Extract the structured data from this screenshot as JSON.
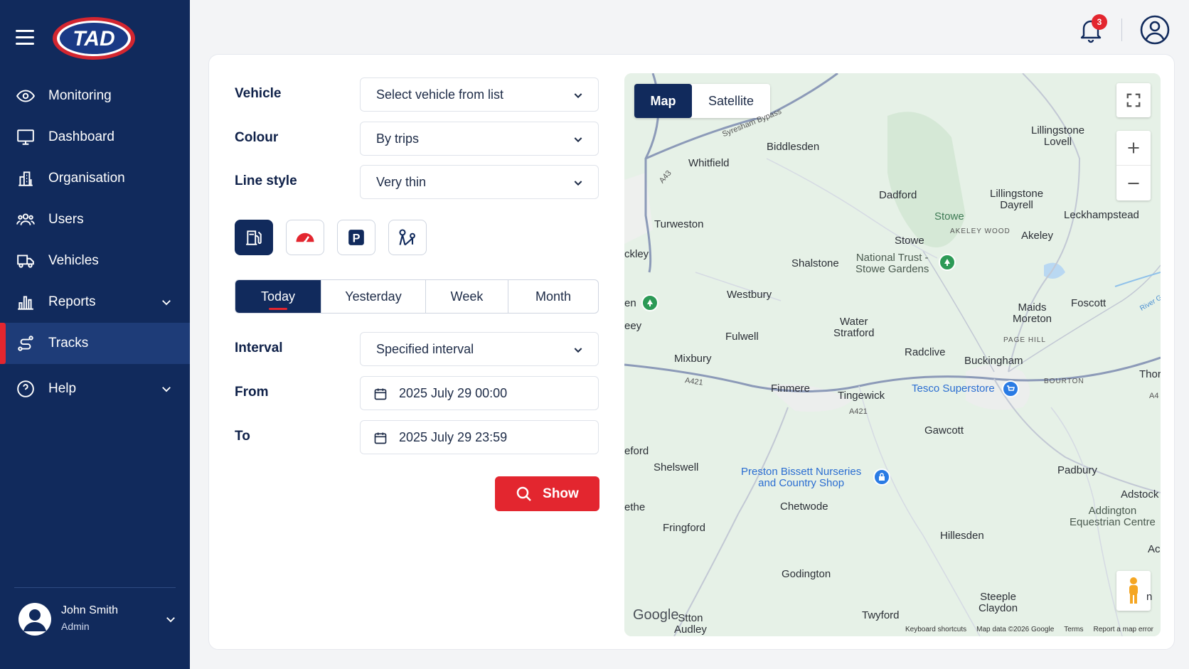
{
  "app": {
    "logo_text": "TAD"
  },
  "sidebar": {
    "items": [
      {
        "label": "Monitoring",
        "icon": "eye-icon"
      },
      {
        "label": "Dashboard",
        "icon": "monitor-icon"
      },
      {
        "label": "Organisation",
        "icon": "building-icon"
      },
      {
        "label": "Users",
        "icon": "users-icon"
      },
      {
        "label": "Vehicles",
        "icon": "truck-icon"
      },
      {
        "label": "Reports",
        "icon": "bar-chart-icon",
        "expandable": true
      },
      {
        "label": "Tracks",
        "icon": "route-icon",
        "active": true
      },
      {
        "label": "Help",
        "icon": "help-circle-icon",
        "expandable": true
      }
    ],
    "user": {
      "name": "John Smith",
      "role": "Admin"
    }
  },
  "header": {
    "notifications_count": "3"
  },
  "form": {
    "vehicle": {
      "label": "Vehicle",
      "value": "Select vehicle from list"
    },
    "colour": {
      "label": "Colour",
      "value": "By trips"
    },
    "line_style": {
      "label": "Line style",
      "value": "Very thin"
    },
    "toggles": [
      {
        "icon": "fuel-icon",
        "on": true
      },
      {
        "icon": "speedometer-icon",
        "on": false
      },
      {
        "icon": "parking-icon",
        "on": false
      },
      {
        "icon": "route-stops-icon",
        "on": false
      }
    ],
    "periods": [
      "Today",
      "Yesterday",
      "Week",
      "Month"
    ],
    "active_period": "Today",
    "interval": {
      "label": "Interval",
      "value": "Specified interval"
    },
    "from": {
      "label": "From",
      "value": "2025 July 29 00:00"
    },
    "to": {
      "label": "To",
      "value": "2025 July 29 23:59"
    },
    "show_label": "Show"
  },
  "map": {
    "type_map": "Map",
    "type_satellite": "Satellite",
    "places": {
      "biddlesden": "Biddlesden",
      "whitfield": "Whitfield",
      "lillingstone_lovell": "Lillingstone\nLovell",
      "dadford": "Dadford",
      "lillingstone_dayrell": "Lillingstone\nDayrell",
      "stowe1": "Stowe",
      "leckhampstead": "Leckhampstead",
      "turweston": "Turweston",
      "akeley_wood": "AKELEY WOOD",
      "akeley": "Akeley",
      "stowe2": "Stowe",
      "brackley": "ckley",
      "shalstone": "Shalstone",
      "national_trust": "National Trust -\nStowe Gardens",
      "westbury": "Westbury",
      "foscott": "Foscott",
      "river": "River G",
      "maids_moreton": "Maids\nMoreton",
      "evenley": "en",
      "eey": "eey",
      "water_stratford": "Water\nStratford",
      "fulwell": "Fulwell",
      "page_hill": "PAGE HILL",
      "radclive": "Radclive",
      "mixbury": "Mixbury",
      "buckingham": "Buckingham",
      "thorn": "Thorn",
      "bourton": "BOURTON",
      "finmere": "Finmere",
      "tingewick": "Tingewick",
      "tesco": "Tesco Superstore",
      "gawcott": "Gawcott",
      "eford": "eford",
      "shelswell": "Shelswell",
      "preston_bissett": "Preston Bissett Nurseries\nand Country Shop",
      "padbury": "Padbury",
      "adstock": "Adstock",
      "ethe": "ethe",
      "chetwode": "Chetwode",
      "addington": "Addington\nEquestrian Centre",
      "fringford": "Fringford",
      "ac": "Ac",
      "hillesden": "Hillesden",
      "godington": "Godington",
      "steeple_claydon": "Steeple\nClaydon",
      "twyford": "Twyford",
      "stratton_audley": "Stton\nAudley",
      "n": "n"
    },
    "roads": {
      "syresham": "Syresham Bypass",
      "a43": "A43",
      "a421a": "A421",
      "a421b": "A421",
      "a4": "A4"
    },
    "google": "Google",
    "attribution": [
      "Keyboard shortcuts",
      "Map data ©2026 Google",
      "Terms",
      "Report a map error"
    ]
  }
}
